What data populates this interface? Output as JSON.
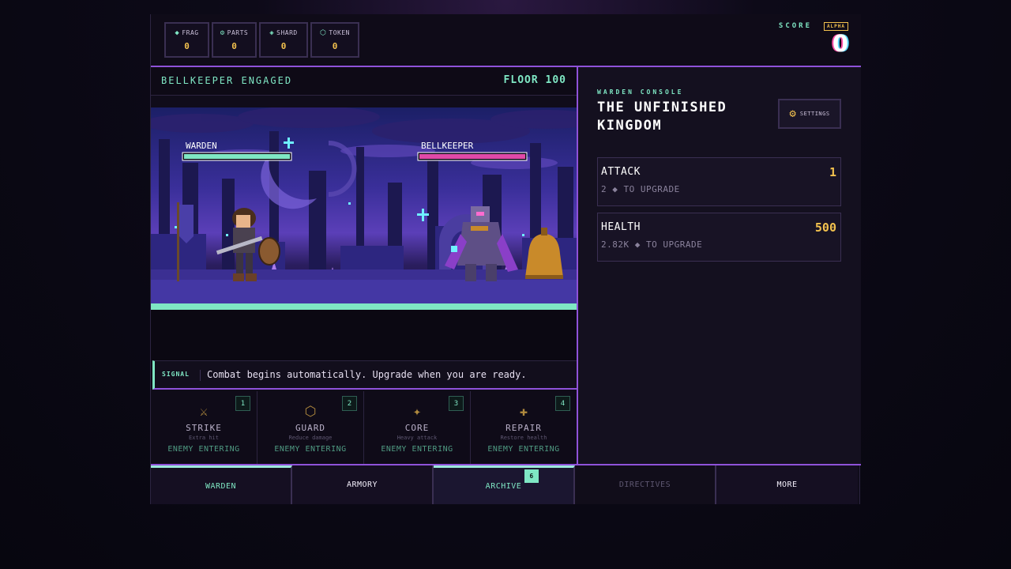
{
  "resources": [
    {
      "icon": "diamond-icon",
      "glyph": "◆",
      "label": "FRAG",
      "value": "0"
    },
    {
      "icon": "gear-icon",
      "glyph": "⚙",
      "label": "PARTS",
      "value": "0"
    },
    {
      "icon": "shard-icon",
      "glyph": "◈",
      "label": "SHARD",
      "value": "0"
    },
    {
      "icon": "token-icon",
      "glyph": "⬡",
      "label": "TOKEN",
      "value": "0"
    }
  ],
  "score": {
    "label": "SCORE",
    "badge": "ALPHA",
    "value": "0"
  },
  "encounter": {
    "title": "BELLKEEPER ENGAGED",
    "floor": "FLOOR 100"
  },
  "battle": {
    "player": {
      "name": "WARDEN",
      "hp": 1.0,
      "color": "#7fe7c4"
    },
    "enemy": {
      "name": "BELLKEEPER",
      "hp": 1.0,
      "color": "#e04aa8"
    }
  },
  "signal": {
    "label": "SIGNAL",
    "text": "Combat begins automatically. Upgrade when you are ready."
  },
  "skills": [
    {
      "icon": "swords-icon",
      "glyph": "⚔",
      "name": "STRIKE",
      "desc": "Extra hit",
      "state": "ENEMY ENTERING",
      "key": "1"
    },
    {
      "icon": "shield-icon",
      "glyph": "⬡",
      "name": "GUARD",
      "desc": "Reduce damage",
      "state": "ENEMY ENTERING",
      "key": "2"
    },
    {
      "icon": "star-icon",
      "glyph": "✦",
      "name": "CORE",
      "desc": "Heavy attack",
      "state": "ENEMY ENTERING",
      "key": "3"
    },
    {
      "icon": "cross-icon",
      "glyph": "✚",
      "name": "REPAIR",
      "desc": "Restore health",
      "state": "ENEMY ENTERING",
      "key": "4"
    }
  ],
  "console": {
    "label": "WARDEN CONSOLE",
    "title": "THE UNFINISHED KINGDOM",
    "settings_label": "SETTINGS",
    "stats": [
      {
        "name": "ATTACK",
        "value": "1",
        "cost": "2 ◆ TO UPGRADE"
      },
      {
        "name": "HEALTH",
        "value": "500",
        "cost": "2.82K ◆ TO UPGRADE"
      }
    ]
  },
  "nav": [
    {
      "label": "WARDEN",
      "state": "active"
    },
    {
      "label": "ARMORY",
      "state": "normal"
    },
    {
      "label": "ARCHIVE",
      "state": "archive",
      "badge": "6"
    },
    {
      "label": "DIRECTIVES",
      "state": "disabled"
    },
    {
      "label": "MORE",
      "state": "normal"
    }
  ],
  "colors": {
    "accent": "#8f52d9",
    "mint": "#7fe7c4",
    "gold": "#f2c14e",
    "enemy": "#e04aa8"
  }
}
